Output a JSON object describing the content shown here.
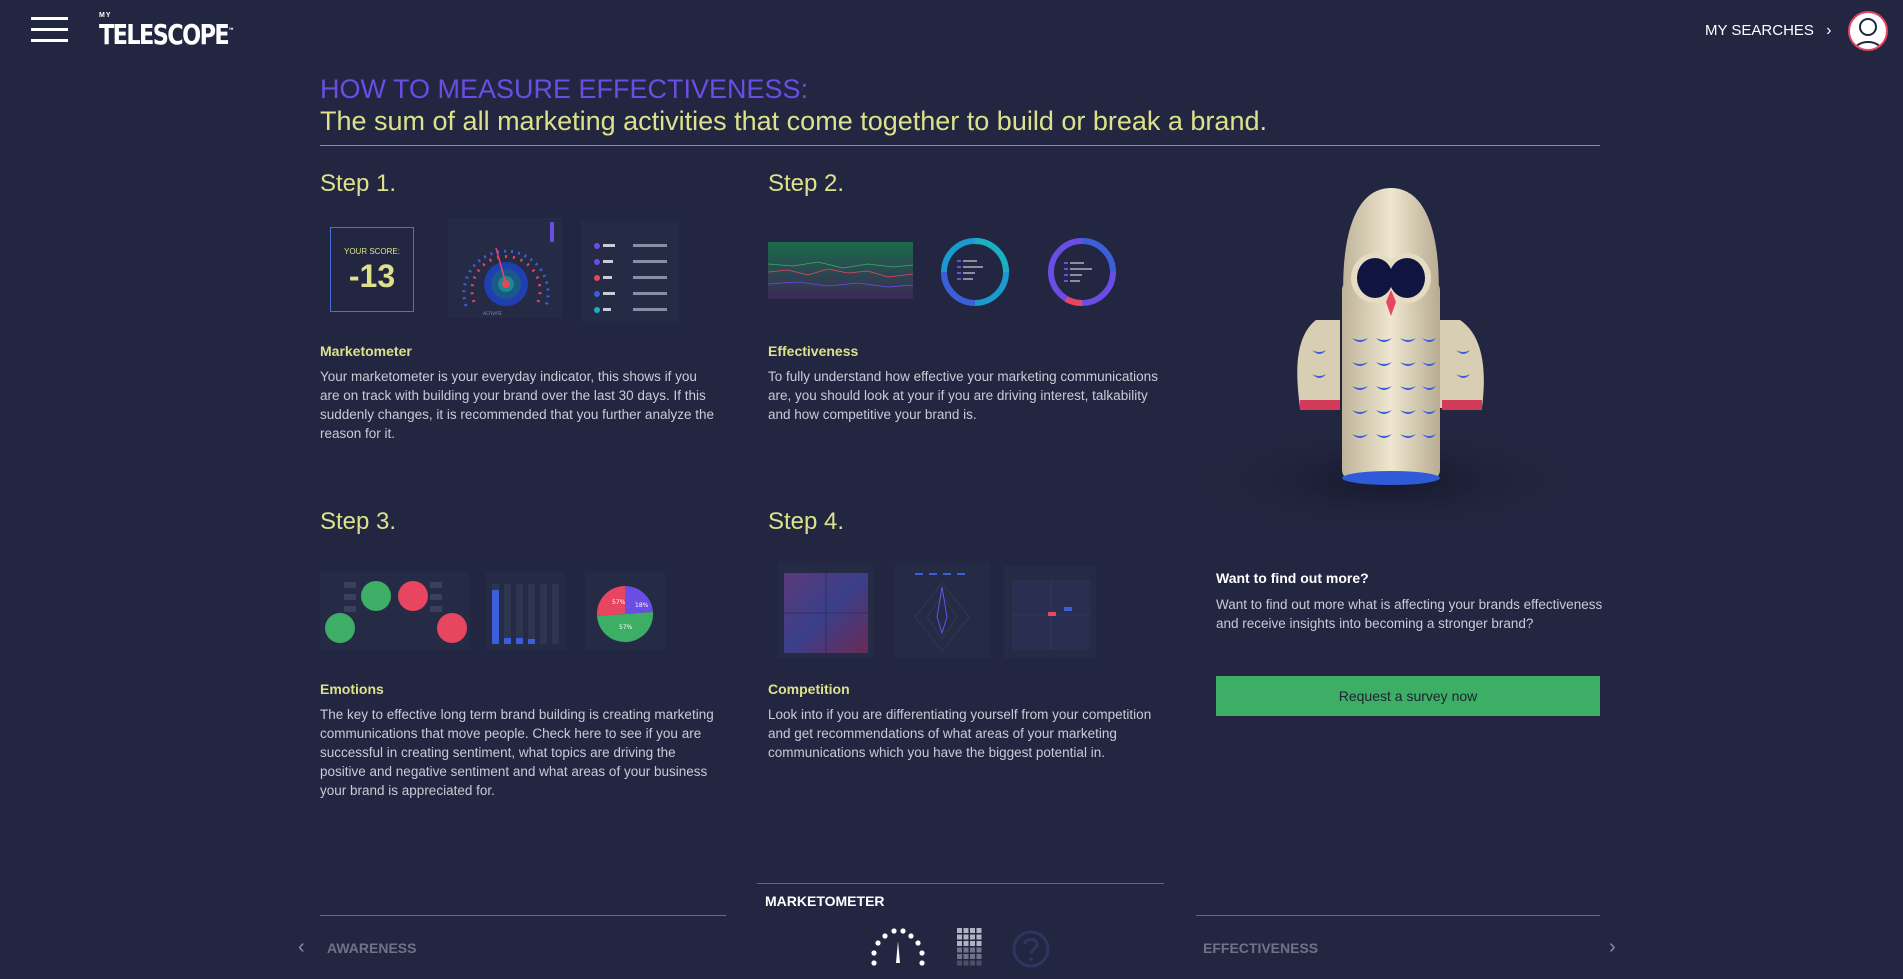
{
  "header": {
    "logo_small": "MY",
    "logo_name": "TELESCOPE",
    "logo_tm": "™",
    "my_searches": "MY SEARCHES",
    "chevron": "›"
  },
  "page": {
    "title": "HOW TO MEASURE EFFECTIVENESS:",
    "subtitle": "The sum of all marketing activities that come together to build or break a brand."
  },
  "steps": [
    {
      "step": "Step 1.",
      "title": "Marketometer",
      "text": "Your marketometer is your everyday indicator, this shows if you are on track with building your brand over the last 30 days. If this suddenly changes, it is recommended that you further analyze the reason for it.",
      "score_label": "YOUR SCORE:",
      "score_value": "-13"
    },
    {
      "step": "Step 2.",
      "title": "Effectiveness",
      "text": "To fully understand how effective your marketing communications are, you should look at your if you are driving interest, talkability and how competitive your brand is."
    },
    {
      "step": "Step 3.",
      "title": "Emotions",
      "text": "The key to effective long term brand building is creating marketing communications that move people. Check here to see if you are successful in creating sentiment, what topics are driving the positive and negative sentiment and what areas of your business your brand is appreciated for.",
      "pie_labels": [
        "57%",
        "18%",
        "57%"
      ]
    },
    {
      "step": "Step 4.",
      "title": "Competition",
      "text": "Look into if you are differentiating yourself from your competition and get recommendations of what areas of your marketing communications which you have the biggest potential in."
    }
  ],
  "cta": {
    "title": "Want to find out more?",
    "text": "Want to find out more what is affecting your brands effectiveness and receive insights into becoming a stronger brand?",
    "button": "Request a survey now"
  },
  "bottom_nav": {
    "prev": "AWARENESS",
    "current": "MARKETOMETER",
    "next": "EFFECTIVENESS",
    "prev_arrow": "‹",
    "next_arrow": "›",
    "icons": [
      "gauge-icon",
      "grid-icon",
      "help-icon"
    ]
  },
  "colors": {
    "background": "#222640",
    "accent_purple": "#6b4de6",
    "accent_yellow": "#dde28a",
    "cta_green": "#3dae66",
    "pink": "#e84561"
  }
}
